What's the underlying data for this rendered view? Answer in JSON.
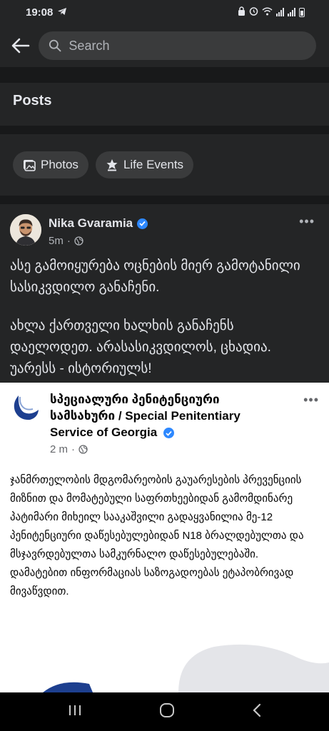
{
  "status_bar": {
    "time": "19:08"
  },
  "search": {
    "placeholder": "Search"
  },
  "posts_section": {
    "title": "Posts"
  },
  "filters": [
    {
      "label": "Photos",
      "icon": "photos-icon"
    },
    {
      "label": "Life Events",
      "icon": "life-events-icon"
    }
  ],
  "post": {
    "author": "Nika Gvaramia",
    "time": "5m",
    "text_1": "ასე გამოიყურება ოცნების მიერ გამოტანილი სასიკვდილო განაჩენი.",
    "text_2": "ახლა ქართველი ხალხის განაჩენს დაელოდეთ. არასასიკვდილოს, ცხადია. უარესს - ისტორიულს!",
    "shared": {
      "author": "სპეციალური პენიტენციური სამსახური / Special Penitentiary Service of Georgia",
      "time": "2 m",
      "text": "ჯანმრთელობის მდგომარეობის გაუარესების პრევენციის მიზნით და მომატებული საფრთხეებიდან გამომდინარე პატიმარი მიხეილ სააკაშვილი გადაყვანილია მე-12 პენიტენციური დაწესებულებიდან N18 ბრალდებულთა და მსჯავრდებულთა სამკურნალო დაწესებულებაში. დამატებით ინფორმაციას საზოგადოებას ეტაპობრივად მივაწვდით."
    }
  },
  "colors": {
    "background": "#18191a",
    "surface": "#242526",
    "chip": "#3a3b3c",
    "verified": "#2d88ff",
    "text_secondary": "#b0b3b8"
  }
}
